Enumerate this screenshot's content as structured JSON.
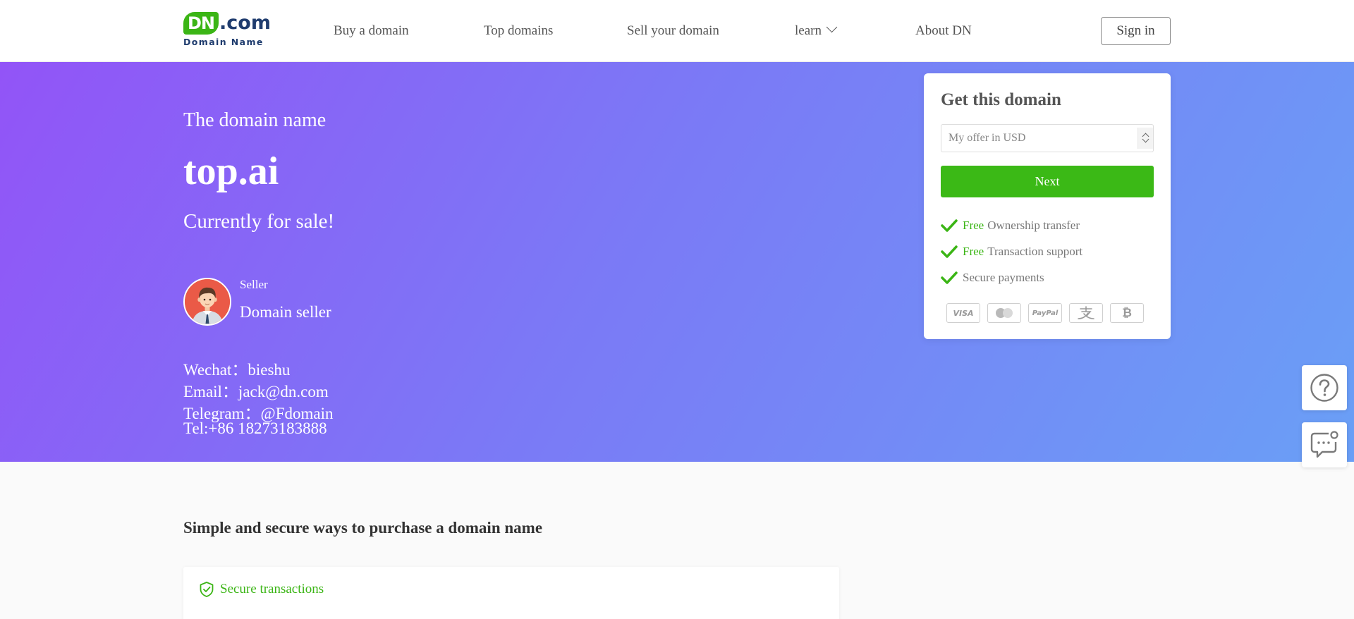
{
  "header": {
    "logo": {
      "dn": "DN",
      "com": ".com",
      "sub": "Domain Name"
    },
    "nav": [
      {
        "label": "Buy a domain"
      },
      {
        "label": "Top domains"
      },
      {
        "label": "Sell your domain"
      },
      {
        "label": "learn"
      },
      {
        "label": "About DN"
      }
    ],
    "signin_label": "Sign in"
  },
  "hero": {
    "subtitle": "The domain name",
    "domain": "top.ai",
    "status": "Currently for sale!",
    "seller": {
      "label": "Seller",
      "name": "Domain seller"
    },
    "contacts": {
      "wechat": "Wechat：bieshu",
      "email": "Email：jack@dn.com",
      "telegram": "Telegram：@Fdomain",
      "tel": "Tel:+86 18273183888"
    }
  },
  "offer_card": {
    "title": "Get this domain",
    "placeholder": "My offer in USD",
    "next_label": "Next",
    "features": [
      {
        "free": "Free",
        "text": "Ownership transfer"
      },
      {
        "free": "Free",
        "text": "Transaction support"
      },
      {
        "free": "",
        "text": "Secure payments"
      }
    ],
    "payment_methods": [
      {
        "name": "visa",
        "label": "VISA"
      },
      {
        "name": "mastercard",
        "label": ""
      },
      {
        "name": "paypal",
        "label": "PayPal"
      },
      {
        "name": "alipay",
        "label": ""
      },
      {
        "name": "bitcoin",
        "label": "₿"
      }
    ]
  },
  "floating": {
    "help_icon": "question-icon",
    "chat_icon": "chat-icon"
  },
  "section": {
    "title": "Simple and secure ways to purchase a domain name",
    "card_heading": "Secure transactions"
  },
  "colors": {
    "accent_green": "#3bb916",
    "brand_navy": "#1f3c6e",
    "hero_gradient_start": "#9254f7",
    "hero_gradient_end": "#6a9ff6"
  }
}
